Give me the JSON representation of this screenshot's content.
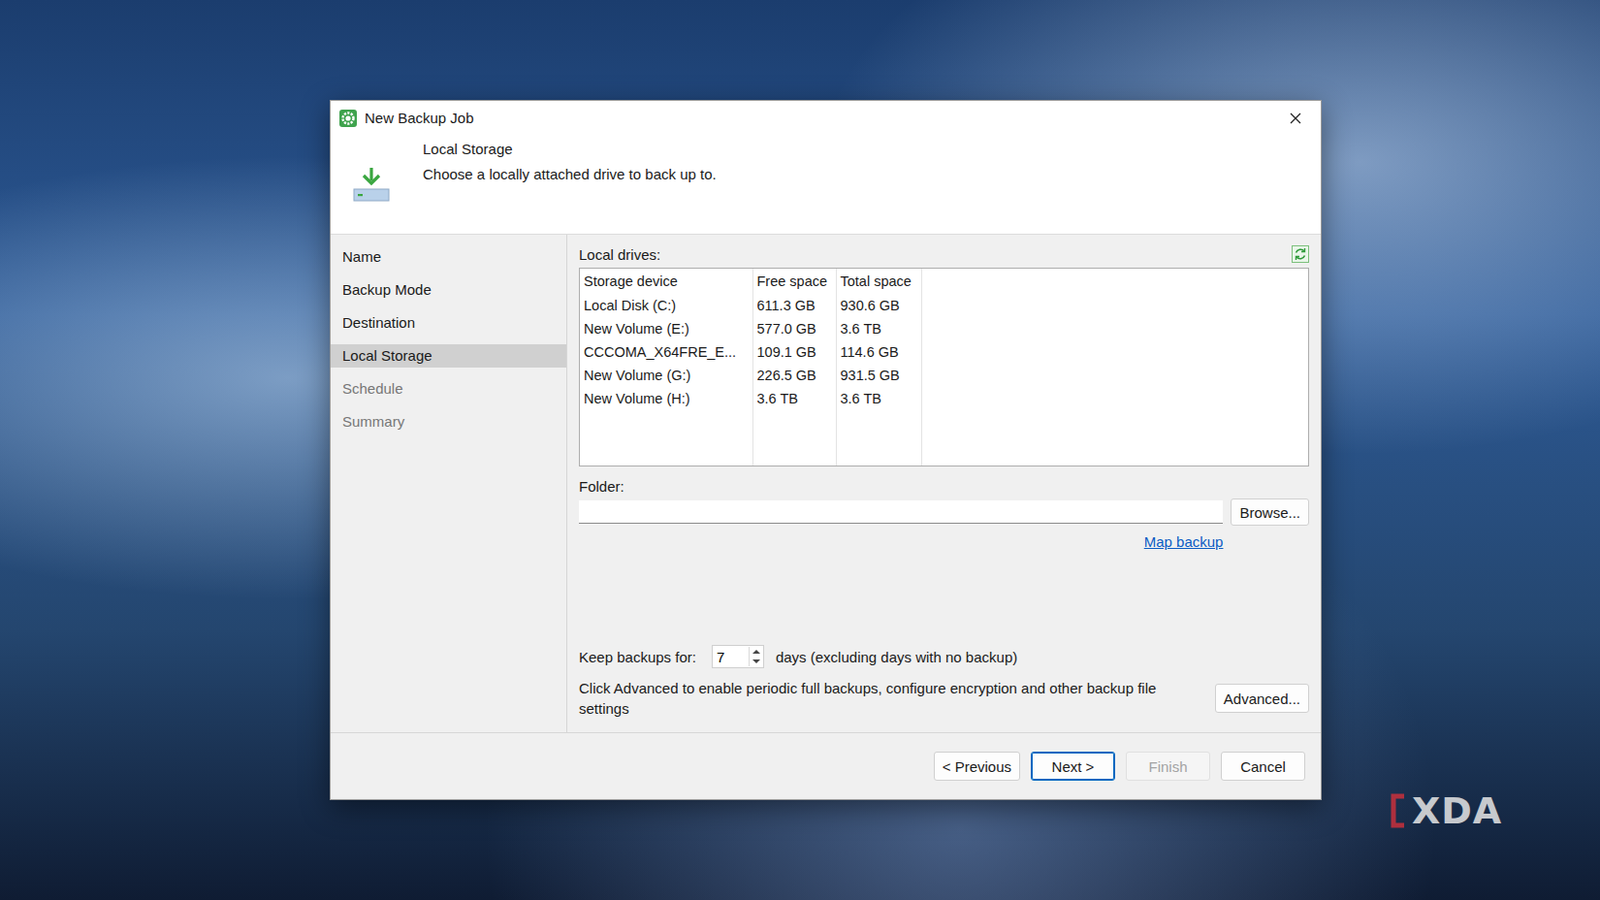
{
  "window": {
    "title": "New Backup Job"
  },
  "header": {
    "title": "Local Storage",
    "description": "Choose a locally attached drive to back up to."
  },
  "sidebar": {
    "items": [
      {
        "label": "Name",
        "selected": false,
        "disabled": false
      },
      {
        "label": "Backup Mode",
        "selected": false,
        "disabled": false
      },
      {
        "label": "Destination",
        "selected": false,
        "disabled": false
      },
      {
        "label": "Local Storage",
        "selected": true,
        "disabled": false
      },
      {
        "label": "Schedule",
        "selected": false,
        "disabled": true
      },
      {
        "label": "Summary",
        "selected": false,
        "disabled": true
      }
    ]
  },
  "drives": {
    "label": "Local drives:",
    "columns": [
      "Storage device",
      "Free space",
      "Total space"
    ],
    "rows": [
      {
        "cells": [
          "Local Disk (C:)",
          "611.3 GB",
          "930.6 GB"
        ],
        "selected": false
      },
      {
        "cells": [
          "New Volume (E:)",
          "577.0 GB",
          "3.6 TB"
        ],
        "selected": false
      },
      {
        "cells": [
          "CCCOMA_X64FRE_E...",
          "109.1 GB",
          "114.6 GB"
        ],
        "selected": false
      },
      {
        "cells": [
          "New Volume (G:)",
          "226.5 GB",
          "931.5 GB"
        ],
        "selected": false
      },
      {
        "cells": [
          "New Volume (H:)",
          "3.6 TB",
          "3.6 TB"
        ],
        "selected": false
      }
    ]
  },
  "folder": {
    "label": "Folder:",
    "value": "",
    "browse": "Browse...",
    "link": "Map backup"
  },
  "retention": {
    "label": "Keep backups for:",
    "value": "7",
    "suffix": "days (excluding days with no backup)"
  },
  "advanced": {
    "hint": "Click Advanced to enable periodic full backups, configure encryption and other backup file settings",
    "button": "Advanced..."
  },
  "buttons": [
    {
      "label": "< Previous",
      "disabled": false,
      "default": false
    },
    {
      "label": "Next >",
      "disabled": false,
      "default": true
    },
    {
      "label": "Finish",
      "disabled": true,
      "default": false
    },
    {
      "label": "Cancel",
      "disabled": false,
      "default": false
    }
  ],
  "watermark": "XDA"
}
